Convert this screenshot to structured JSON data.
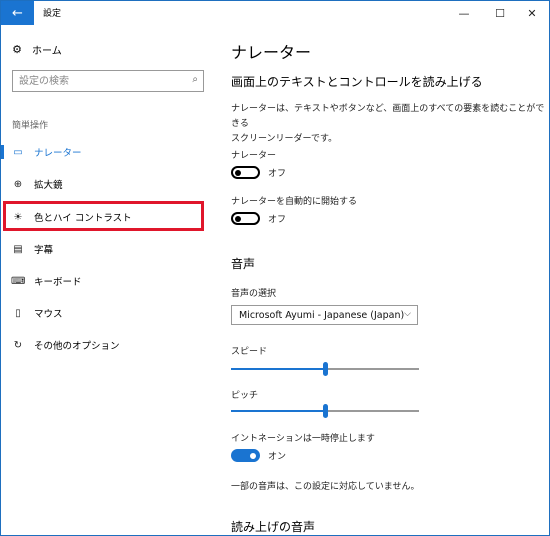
{
  "titlebar": {
    "title": "設定",
    "back_icon": "←",
    "minimize_icon": "—",
    "maximize_icon": "☐",
    "close_icon": "✕"
  },
  "sidebar": {
    "home": {
      "label": "ホーム",
      "icon": "⚙"
    },
    "search": {
      "placeholder": "設定の検索",
      "value": ""
    },
    "section_label": "簡単操作",
    "items": [
      {
        "label": "ナレーター",
        "icon": "▭",
        "active": true
      },
      {
        "label": "拡大鏡",
        "icon": "⊕",
        "active": false
      },
      {
        "label": "色とハイ コントラスト",
        "icon": "☀",
        "active": false
      },
      {
        "label": "字幕",
        "icon": "▤",
        "active": false
      },
      {
        "label": "キーボード",
        "icon": "⌨",
        "active": false
      },
      {
        "label": "マウス",
        "icon": "▯",
        "active": false
      },
      {
        "label": "その他のオプション",
        "icon": "↻",
        "active": false
      }
    ]
  },
  "main": {
    "title": "ナレーター",
    "subtitle": "画面上のテキストとコントロールを読み上げる",
    "description_line1": "ナレーターは、テキストやボタンなど、画面上のすべての要素を読むことができる",
    "description_line2": "スクリーンリーダーです。",
    "narrator_label": "ナレーター",
    "narrator_toggle_state": "オフ",
    "autostart_label": "ナレーターを自動的に開始する",
    "autostart_toggle_state": "オフ",
    "voice_section": "音声",
    "voice_select_label": "音声の選択",
    "voice_selected": "Microsoft Ayumi - Japanese (Japan)",
    "speed_label": "スピード",
    "speed_value": 0.5,
    "pitch_label": "ピッチ",
    "pitch_value": 0.5,
    "intonation_label": "イントネーションは一時停止します",
    "intonation_toggle_state": "オン",
    "note": "一部の音声は、この設定に対応していません。",
    "reading_section": "読み上げの音声"
  },
  "colors": {
    "accent": "#1a74d1",
    "highlight": "#e0162b"
  }
}
